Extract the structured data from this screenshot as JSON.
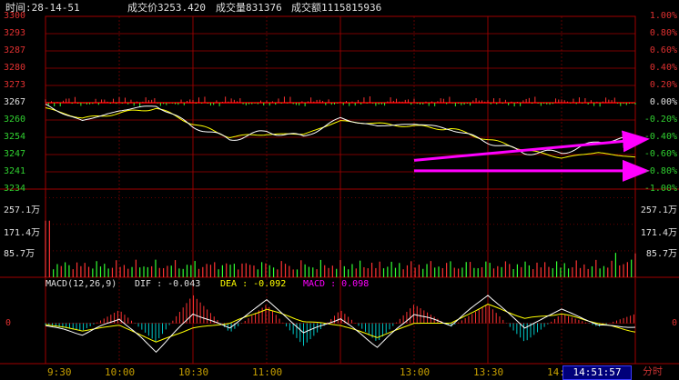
{
  "header": {
    "time_label": "时间:28-14-51",
    "price_label": "成交价3253.420",
    "volume_label": "成交量831376",
    "amount_label": "成交额1115815936"
  },
  "price_axis": {
    "left_ticks": [
      "3300",
      "3293",
      "3287",
      "3280",
      "3273",
      "3267",
      "3260",
      "3254",
      "3247",
      "3241",
      "3234"
    ],
    "right_ticks": [
      "1.00%",
      "0.80%",
      "0.60%",
      "0.40%",
      "0.20%",
      "0.00%",
      "-0.20%",
      "-0.40%",
      "-0.60%",
      "-0.80%",
      "-1.00%"
    ]
  },
  "volume_axis": {
    "ticks": [
      "257.1万",
      "171.4万",
      "85.7万"
    ]
  },
  "macd": {
    "title": "MACD(12,26,9)",
    "dif_label": "DIF : -0.043",
    "dea_label": "DEA : -0.092",
    "macd_label": "MACD : 0.098",
    "zero_label": "0",
    "colors": {
      "title": "#e0e0e0",
      "dif": "#e0e0e0",
      "dea": "#ffff00",
      "macd": "#ff00ff"
    }
  },
  "time_axis": {
    "labels": [
      "9:30",
      "10:00",
      "10:30",
      "11:00",
      "13:00",
      "13:30",
      "14:00"
    ]
  },
  "status": {
    "clock": "14:51:57",
    "ticker": "分时"
  },
  "chart_data": [
    {
      "type": "line",
      "x": [
        0,
        15,
        30,
        45,
        60,
        75,
        90,
        105,
        120,
        135,
        150,
        165,
        180,
        195,
        210,
        225,
        240
      ],
      "series": [
        {
          "values": [
            3266,
            3260,
            3264,
            3266,
            3258,
            3253,
            3256,
            3254,
            3261,
            3258,
            3259,
            3257,
            3252,
            3248,
            3248,
            3252,
            3254
          ]
        },
        {
          "values": [
            3265,
            3261,
            3263,
            3265,
            3259,
            3254,
            3255,
            3255,
            3260,
            3259,
            3258,
            3257,
            3253,
            3249,
            3246,
            3248,
            3246
          ]
        }
      ],
      "annotations": [
        {
          "type": "arrow",
          "x": [
            150,
            240
          ],
          "y": [
            3245,
            3253
          ]
        },
        {
          "type": "arrow",
          "x": [
            150,
            240
          ],
          "y": [
            3241,
            3241
          ]
        }
      ],
      "ylim": [
        3234,
        3300
      ],
      "reference_line": 3267,
      "colors": {
        "price": "#ffffff",
        "average": "#ffff00",
        "arrow": "#ff00ff",
        "grid": "#a00000"
      }
    },
    {
      "type": "bar",
      "x": [
        0,
        240
      ],
      "ylim": [
        0,
        342.8
      ],
      "avg_level": 55,
      "spike_level": 220,
      "colors": {
        "up": "#ff3232",
        "down": "#32ff32"
      }
    },
    {
      "type": "bar",
      "x": [
        0,
        15,
        30,
        45,
        60,
        75,
        90,
        105,
        120,
        135,
        150,
        165,
        180,
        195,
        210,
        225,
        240
      ],
      "dif": [
        -0.02,
        -0.12,
        0.05,
        -0.3,
        0.1,
        -0.05,
        0.25,
        -0.1,
        0.05,
        -0.25,
        0.1,
        -0.02,
        0.3,
        -0.05,
        0.15,
        -0.02,
        -0.043
      ],
      "dea": [
        -0.01,
        -0.08,
        -0.02,
        -0.2,
        -0.05,
        0.0,
        0.15,
        0.02,
        -0.02,
        -0.15,
        0.0,
        0.0,
        0.2,
        0.05,
        0.1,
        0.0,
        -0.092
      ],
      "ylim": [
        -0.4,
        0.4
      ],
      "colors": {
        "pos": "#ff3232",
        "neg": "#00c8c8",
        "dif": "#ffffff",
        "dea": "#ffff00"
      }
    }
  ]
}
